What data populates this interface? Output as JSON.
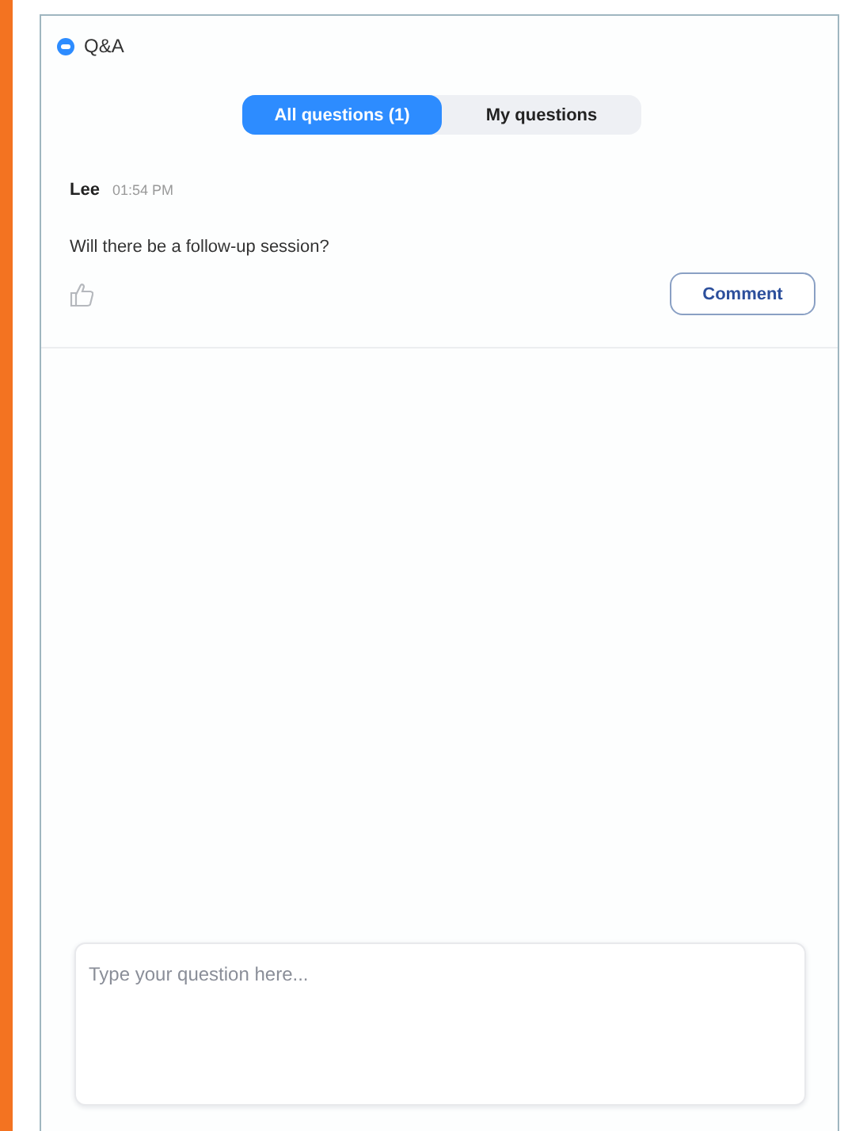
{
  "window": {
    "title": "Q&A"
  },
  "tabs": [
    {
      "label": "All questions (1)",
      "selected": true
    },
    {
      "label": "My questions",
      "selected": false
    }
  ],
  "questions": [
    {
      "author": "Lee",
      "time": "01:54 PM",
      "text": "Will there be a follow-up session?",
      "liked": false,
      "action": "Comment"
    }
  ],
  "question_field": {
    "placeholder": "Type your question here..."
  }
}
